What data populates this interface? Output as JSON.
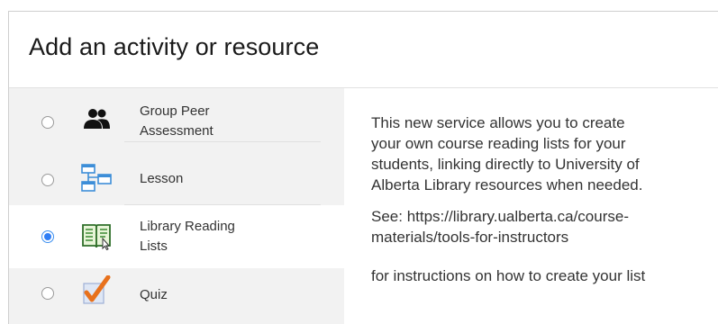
{
  "dialog": {
    "title": "Add an activity or resource"
  },
  "options": [
    {
      "label_line1": "Group Peer",
      "label_line2": "Assessment",
      "icon": "group-people-icon",
      "selected": false
    },
    {
      "label_line1": "Lesson",
      "icon": "lesson-flowchart-icon",
      "selected": false
    },
    {
      "label_line1": "Library Reading",
      "label_line2": "Lists",
      "icon": "reading-list-book-icon",
      "selected": true
    },
    {
      "label_line1": "Quiz",
      "icon": "quiz-checkmark-icon",
      "selected": false
    }
  ],
  "description": {
    "para1_line1": "This new service allows you to create",
    "para1_line2": "your own course reading lists for your",
    "para1_line3": "students, linking directly to University of",
    "para1_line4": "Alberta Library resources when needed.",
    "para2_line1": "See: https://library.ualberta.ca/course-",
    "para2_line2": "materials/tools-for-instructors",
    "para3_line1": "for instructions on how to create your list"
  },
  "colors": {
    "accent": "#2f7ef5",
    "list_background": "#f2f2f2"
  }
}
